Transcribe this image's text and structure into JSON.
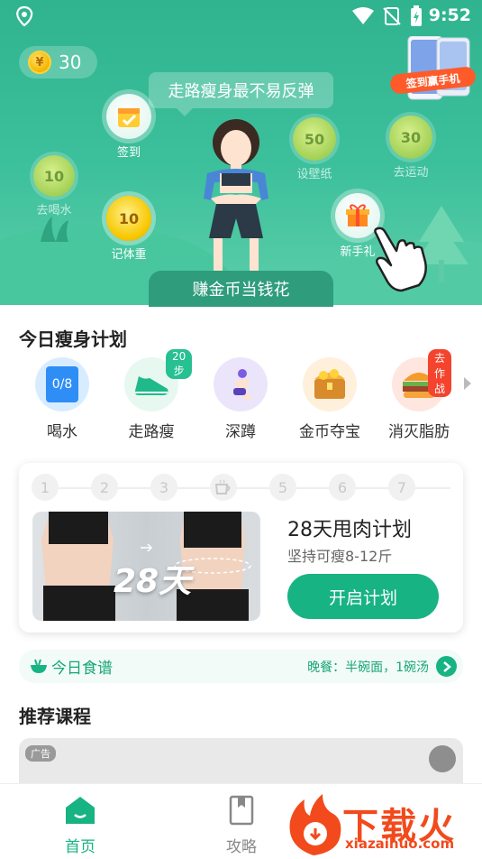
{
  "status_bar": {
    "time": "9:52"
  },
  "hero": {
    "coins": "30",
    "bubble_text": "走路瘦身最不易反弹",
    "earn_text": "赚金币当钱花",
    "promo_text": "签到赢手机",
    "tasks": [
      {
        "value": "10",
        "label": "去喝水"
      },
      {
        "value": "",
        "label": "签到"
      },
      {
        "value": "10",
        "label": "记体重"
      },
      {
        "value": "50",
        "label": "设壁纸"
      },
      {
        "value": "30",
        "label": "去运动"
      },
      {
        "value": "",
        "label": "新手礼"
      }
    ]
  },
  "plan_section": {
    "title": "今日瘦身计划",
    "items": [
      {
        "label": "喝水",
        "badge": "",
        "icon_text": "0/8",
        "icon": "water-cup-icon"
      },
      {
        "label": "走路瘦",
        "badge": "20步",
        "icon": "shoe-icon"
      },
      {
        "label": "深蹲",
        "badge": "",
        "icon": "squat-icon"
      },
      {
        "label": "金币夺宝",
        "badge": "",
        "icon": "treasure-chest-icon"
      },
      {
        "label": "消灭脂肪",
        "badge": "去作战",
        "icon": "burger-icon"
      }
    ]
  },
  "plan_card": {
    "steps": [
      "1",
      "2",
      "3",
      "",
      "5",
      "6",
      "7"
    ],
    "photo_text": "28天",
    "title": "28天甩肉计划",
    "subtitle": "坚持可瘦8-12斤",
    "button": "开启计划"
  },
  "recipe": {
    "label": "今日食谱",
    "meal": "晚餐：半碗面，1碗汤"
  },
  "courses": {
    "title": "推荐课程",
    "ad_tag": "广告"
  },
  "bottom_nav": {
    "items": [
      {
        "label": "首页",
        "active": true
      },
      {
        "label": "攻略",
        "active": false
      }
    ]
  },
  "watermark": {
    "text": "下载火",
    "url": "xiazaihuo.com"
  },
  "colors": {
    "primary": "#17b383",
    "hero": "#3dc09c",
    "accent_red": "#f24a1d"
  }
}
